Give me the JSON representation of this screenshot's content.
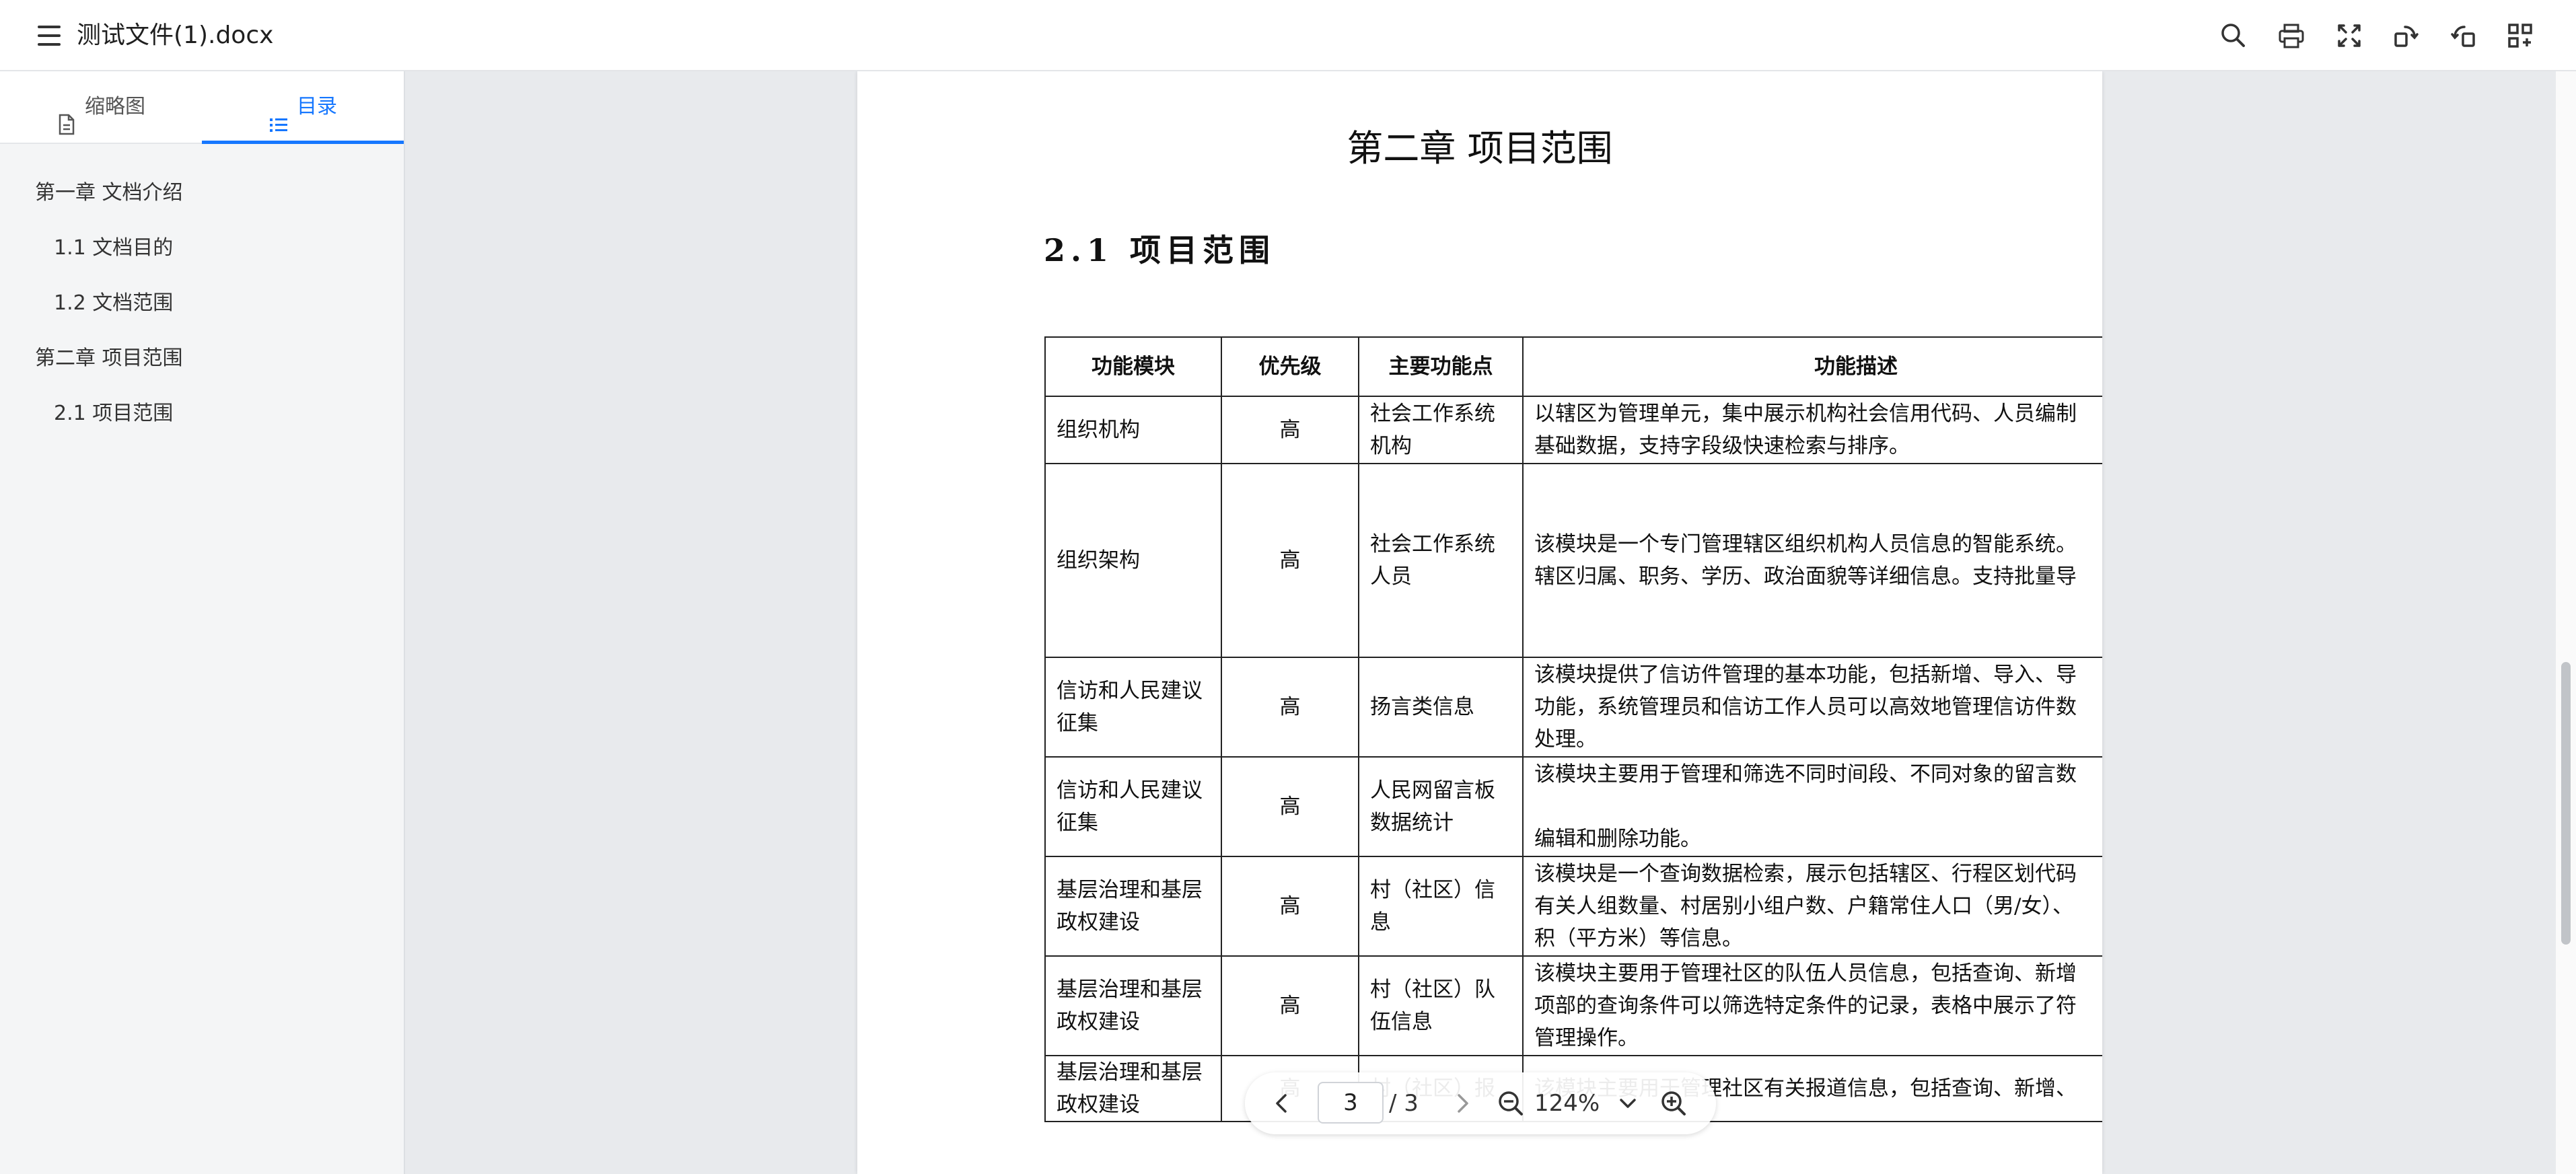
{
  "app": {
    "title": "测试文件(1).docx"
  },
  "toolbar": {
    "icons": [
      "search-icon",
      "print-icon",
      "fullscreen-icon",
      "rotate-right-icon",
      "rotate-left-icon",
      "layout-icon"
    ]
  },
  "sidebar": {
    "tabs": [
      {
        "label": "缩略图",
        "icon": "document-icon",
        "active": false
      },
      {
        "label": "目录",
        "icon": "list-icon",
        "active": true
      }
    ],
    "toc": [
      {
        "label": "第一章 文档介绍",
        "level": 1
      },
      {
        "label": "1.1 文档目的",
        "level": 2
      },
      {
        "label": "1.2 文档范围",
        "level": 2
      },
      {
        "label": "第二章 项目范围",
        "level": 1
      },
      {
        "label": "2.1 项目范围",
        "level": 2
      }
    ]
  },
  "document": {
    "chapter_title": "第二章  项目范围",
    "section_title": "2.1  项目范围",
    "table": {
      "headers": [
        "功能模块",
        "优先级",
        "主要功能点",
        "功能描述"
      ],
      "rows": [
        {
          "module": [
            "组织机构"
          ],
          "priority": "高",
          "point": [
            "社会工作系统",
            "机构"
          ],
          "desc": [
            "以辖区为管理单元，集中展示机构社会信用代码、人员编制",
            "基础数据，支持字段级快速检索与排序。"
          ]
        },
        {
          "module": [
            "组织架构"
          ],
          "priority": "高",
          "point": [
            "社会工作系统",
            "人员"
          ],
          "desc": [
            "该模块是一个专门管理辖区组织机构人员信息的智能系统。",
            "辖区归属、职务、学历、政治面貌等详细信息。支持批量导"
          ]
        },
        {
          "module": [
            "信访和人民建议",
            "征集"
          ],
          "priority": "高",
          "point": [
            "扬言类信息"
          ],
          "desc": [
            "该模块提供了信访件管理的基本功能，包括新增、导入、导",
            "功能，系统管理员和信访工作人员可以高效地管理信访件数",
            "处理。"
          ]
        },
        {
          "module": [
            "信访和人民建议",
            "征集"
          ],
          "priority": "高",
          "point": [
            "人民网留言板",
            "数据统计"
          ],
          "desc": [
            "该模块主要用于管理和筛选不同时间段、不同对象的留言数",
            "",
            "编辑和删除功能。"
          ]
        },
        {
          "module": [
            "基层治理和基层",
            "政权建设"
          ],
          "priority": "高",
          "point": [
            "村（社区）信",
            "息"
          ],
          "desc": [
            "该模块是一个查询数据检索，展示包括辖区、行程区划代码",
            "有关人组数量、村居别小组户数、户籍常住人口（男/女）、",
            "积（平方米）等信息。"
          ]
        },
        {
          "module": [
            "基层治理和基层",
            "政权建设"
          ],
          "priority": "高",
          "point": [
            "村（社区）队",
            "伍信息"
          ],
          "desc": [
            "该模块主要用于管理社区的队伍人员信息，包括查询、新增",
            "项部的查询条件可以筛选特定条件的记录，表格中展示了符",
            "管理操作。"
          ]
        },
        {
          "module": [
            "基层治理和基层",
            "政权建设"
          ],
          "priority": "高",
          "point": [
            "村（社区）报"
          ],
          "desc": [
            "该模块主要用于管理社区有关报道信息，包括查询、新增、"
          ]
        }
      ]
    }
  },
  "pager": {
    "current_page": "3",
    "total": "/ 3",
    "zoom": "124%"
  },
  "scrollbar": {
    "position": 0.72
  }
}
